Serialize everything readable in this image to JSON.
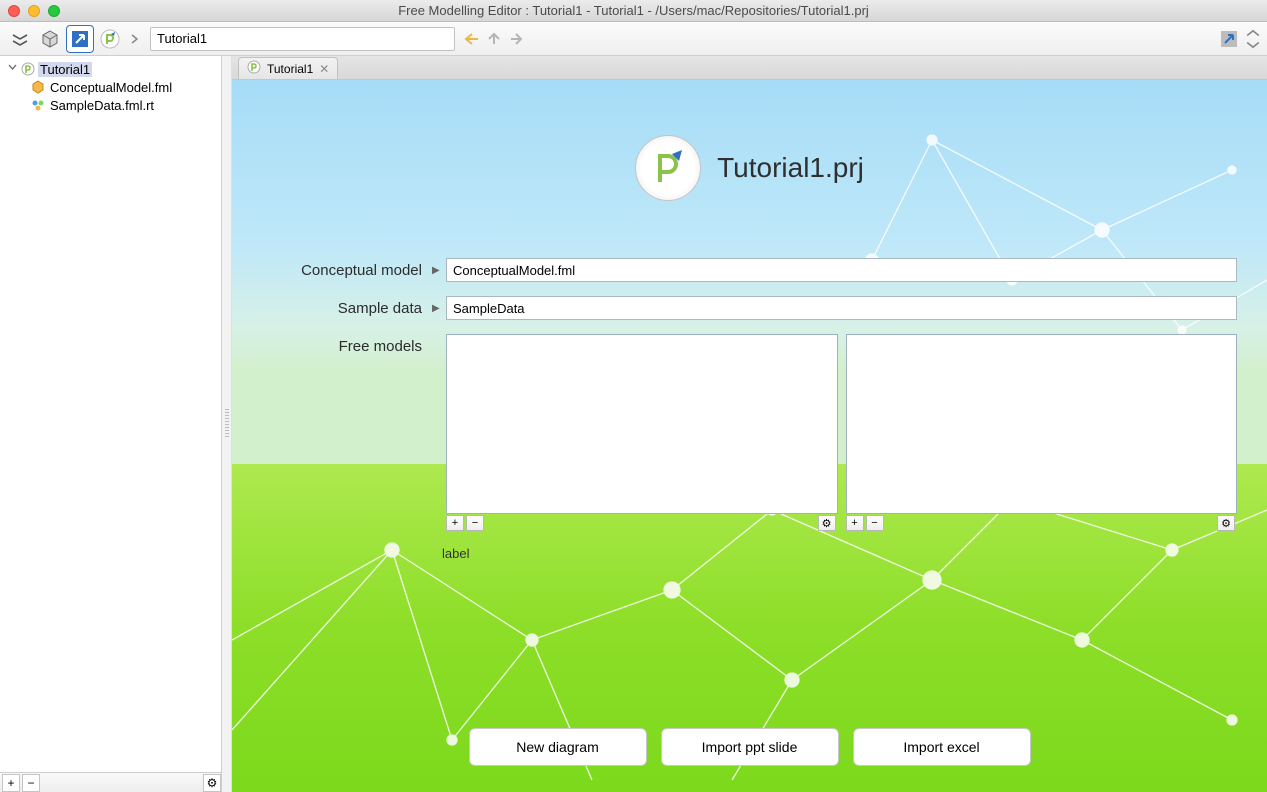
{
  "window": {
    "title": "Free Modelling Editor : Tutorial1 - Tutorial1 - /Users/mac/Repositories/Tutorial1.prj"
  },
  "toolbar": {
    "path": "Tutorial1"
  },
  "tree": {
    "root": {
      "label": "Tutorial1"
    },
    "children": [
      {
        "label": "ConceptualModel.fml"
      },
      {
        "label": "SampleData.fml.rt"
      }
    ]
  },
  "tab": {
    "label": "Tutorial1"
  },
  "hero": {
    "title": "Tutorial1.prj"
  },
  "form": {
    "conceptual_label": "Conceptual model",
    "conceptual_value": "ConceptualModel.fml",
    "sample_label": "Sample data",
    "sample_value": "SampleData",
    "freemodels_label": "Free models",
    "under_label": "label"
  },
  "actions": {
    "new_diagram": "New diagram",
    "import_ppt": "Import ppt slide",
    "import_excel": "Import excel"
  },
  "glyphs": {
    "plus": "+",
    "minus": "−",
    "gear": "⚙",
    "close": "✕",
    "tri_right": "▶",
    "tri_down": "▼"
  }
}
